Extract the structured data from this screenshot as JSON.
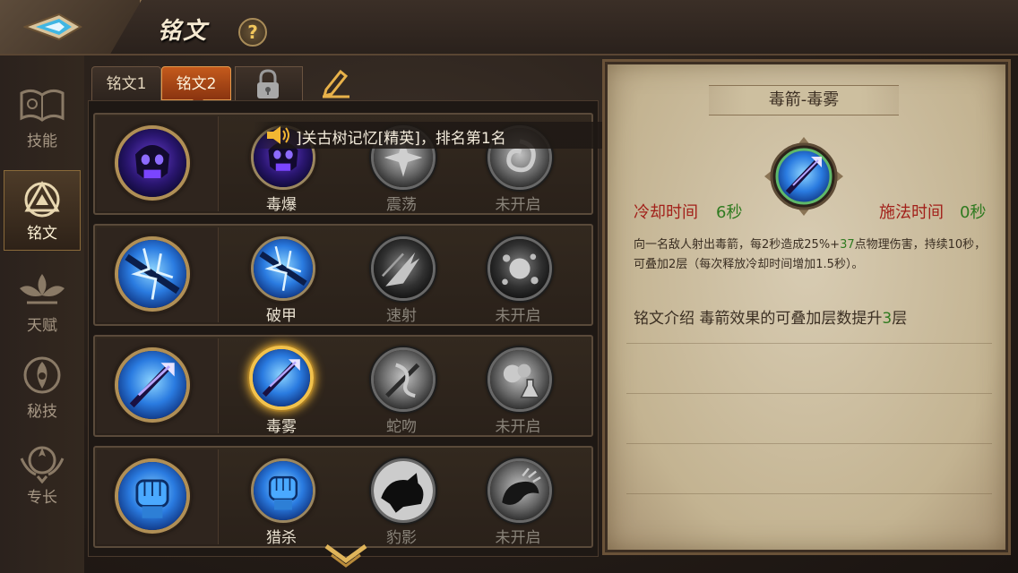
{
  "header": {
    "title": "铭文",
    "help_label": "?"
  },
  "sidebar": {
    "items": [
      {
        "label": "技能",
        "icon": "skill-book-icon",
        "active": false
      },
      {
        "label": "铭文",
        "icon": "rune-triangle-icon",
        "active": true
      },
      {
        "label": "天赋",
        "icon": "talent-lotus-icon",
        "active": false
      },
      {
        "label": "秘技",
        "icon": "secret-art-icon",
        "active": false
      },
      {
        "label": "专长",
        "icon": "specialty-emblem-icon",
        "active": false
      }
    ]
  },
  "tabs": [
    {
      "label": "铭文1",
      "active": false
    },
    {
      "label": "铭文2",
      "active": true
    }
  ],
  "tab_icons": [
    "lock-icon",
    "edit-pencil-icon"
  ],
  "notice": {
    "text": "]关古树记忆[精英]，排名第1名",
    "icon": "speaker-icon"
  },
  "rune_rows": [
    {
      "main_icon": "poison-skull-icon",
      "options": [
        {
          "label": "毒爆",
          "icon": "poison-skull-icon",
          "unlocked": true,
          "selected": false
        },
        {
          "label": "震荡",
          "icon": "shock-burst-icon",
          "unlocked": false,
          "selected": false
        },
        {
          "label": "未开启",
          "icon": "swirl-icon",
          "unlocked": false,
          "selected": false
        }
      ]
    },
    {
      "main_icon": "shatter-arrow-icon",
      "options": [
        {
          "label": "破甲",
          "icon": "shatter-arrow-icon",
          "unlocked": true,
          "selected": false
        },
        {
          "label": "速射",
          "icon": "rapid-shot-icon",
          "unlocked": false,
          "selected": false
        },
        {
          "label": "未开启",
          "icon": "explosion-icon",
          "unlocked": false,
          "selected": false
        }
      ]
    },
    {
      "main_icon": "poison-arrow-icon",
      "options": [
        {
          "label": "毒雾",
          "icon": "poison-arrow-icon",
          "unlocked": true,
          "selected": true
        },
        {
          "label": "蛇吻",
          "icon": "snake-bite-icon",
          "unlocked": false,
          "selected": false
        },
        {
          "label": "未开启",
          "icon": "potion-flask-icon",
          "unlocked": false,
          "selected": false
        }
      ]
    },
    {
      "main_icon": "fist-strike-icon",
      "options": [
        {
          "label": "猎杀",
          "icon": "fist-strike-icon",
          "unlocked": true,
          "selected": false
        },
        {
          "label": "豹影",
          "icon": "panther-icon",
          "unlocked": false,
          "selected": false
        },
        {
          "label": "未开启",
          "icon": "beast-claw-icon",
          "unlocked": false,
          "selected": false
        }
      ]
    }
  ],
  "detail": {
    "title": "毒箭-毒雾",
    "icon": "poison-arrow-icon",
    "cooldown_label": "冷却时间",
    "cooldown_value": "6秒",
    "cast_label": "施法时间",
    "cast_value": "0秒",
    "desc_part1": "向一名敌人射出毒箭，每2秒造成25%+",
    "desc_num": "37",
    "desc_part2": "点物理伤害，持续10秒，可叠加2层（每次释放冷却时间增加1.5秒）。",
    "intro_part1": "铭文介绍  毒箭效果的可叠加层数提升",
    "intro_num": "3",
    "intro_part2": "层"
  },
  "colors": {
    "accent_orange": "#c45a1c",
    "selected_gold": "#f2c24c",
    "cooldown_red": "#a2201a",
    "value_green": "#2f7a20"
  }
}
